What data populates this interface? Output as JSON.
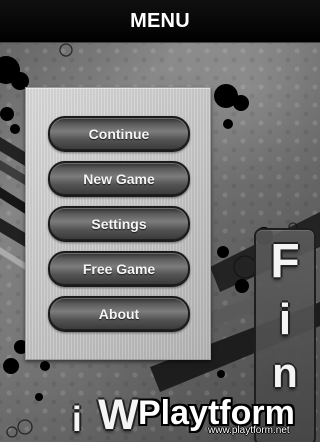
{
  "title_bar": {
    "title": "MENU"
  },
  "menu": {
    "items": [
      {
        "label": "Continue"
      },
      {
        "label": "New Game"
      },
      {
        "label": "Settings"
      },
      {
        "label": "Free Game"
      },
      {
        "label": "About"
      }
    ]
  },
  "logo": {
    "vertical_text": [
      "F",
      "i",
      "n"
    ],
    "bottom_text": [
      "i",
      "W"
    ]
  },
  "watermark": {
    "main": "Playtform",
    "sub": "www.playtform.net"
  },
  "colors": {
    "title_bar": "#000000",
    "title_text": "#FFFFFF",
    "panel": "#C7C7C7",
    "button_dark": "#2F2F2F",
    "button_light": "#7C7C7C",
    "button_text": "#F5F5F5"
  }
}
